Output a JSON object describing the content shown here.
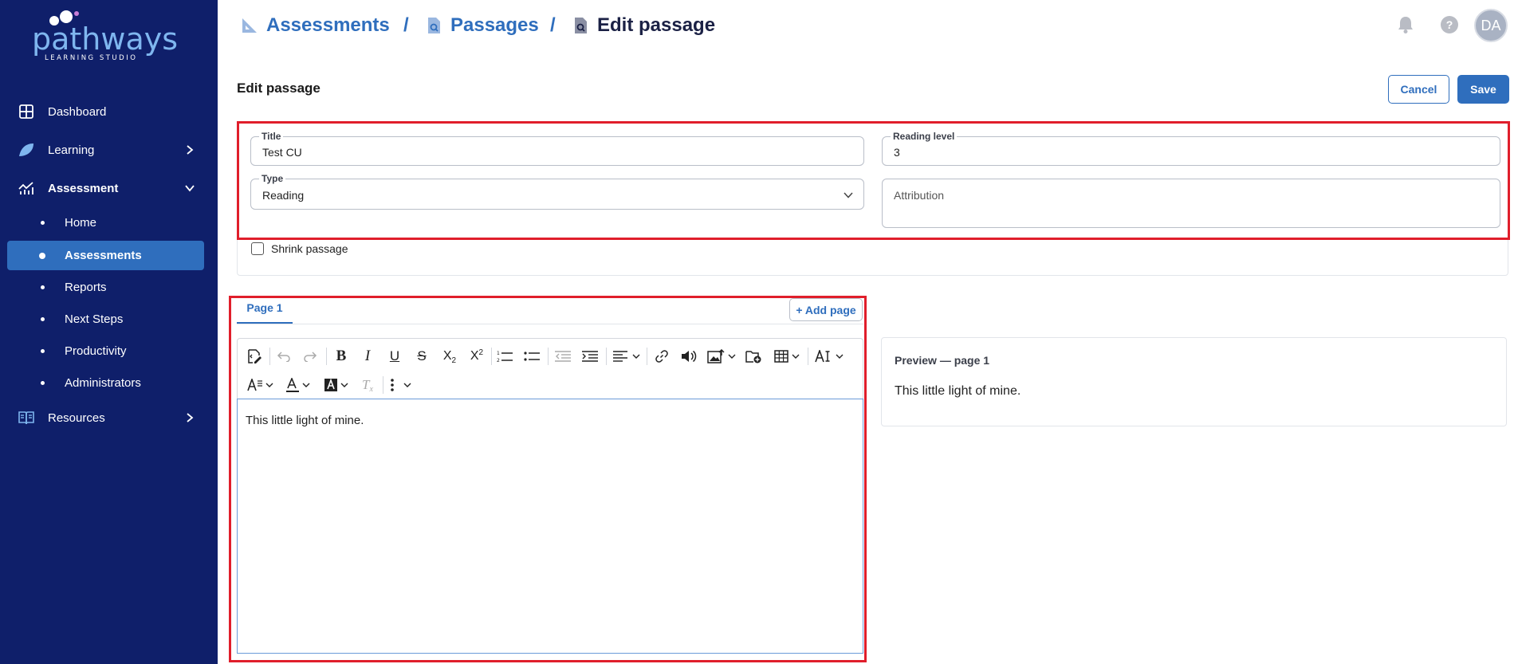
{
  "brand": {
    "name": "pathways",
    "tagline": "LEARNING STUDIO"
  },
  "sidebar": {
    "items": [
      {
        "label": "Dashboard",
        "icon": "grid-icon"
      },
      {
        "label": "Learning",
        "icon": "leaf-icon"
      },
      {
        "label": "Assessment",
        "icon": "chart-icon"
      },
      {
        "label": "Resources",
        "icon": "book-icon"
      }
    ],
    "sub_items": [
      "Home",
      "Assessments",
      "Reports",
      "Next Steps",
      "Productivity",
      "Administrators"
    ],
    "active_sub": "Assessments"
  },
  "breadcrumb": {
    "items": [
      "Assessments",
      "Passages",
      "Edit passage"
    ],
    "separator": "/"
  },
  "header": {
    "help_label": "?",
    "avatar_initials": "DA"
  },
  "page": {
    "title": "Edit passage",
    "cancel_label": "Cancel",
    "save_label": "Save"
  },
  "form": {
    "title_label": "Title",
    "title_value": "Test CU",
    "reading_level_label": "Reading level",
    "reading_level_value": "3",
    "type_label": "Type",
    "type_value": "Reading",
    "attribution_placeholder": "Attribution",
    "shrink_label": "Shrink passage"
  },
  "editor": {
    "tab_label": "Page 1",
    "add_page_label": "+ Add page",
    "content": "This little light of mine."
  },
  "preview": {
    "title": "Preview — page 1",
    "content": "This little light of mine."
  },
  "colors": {
    "sidebar_bg": "#0f1f6a",
    "accent": "#2f6ebd",
    "highlight": "#e01e2b"
  }
}
